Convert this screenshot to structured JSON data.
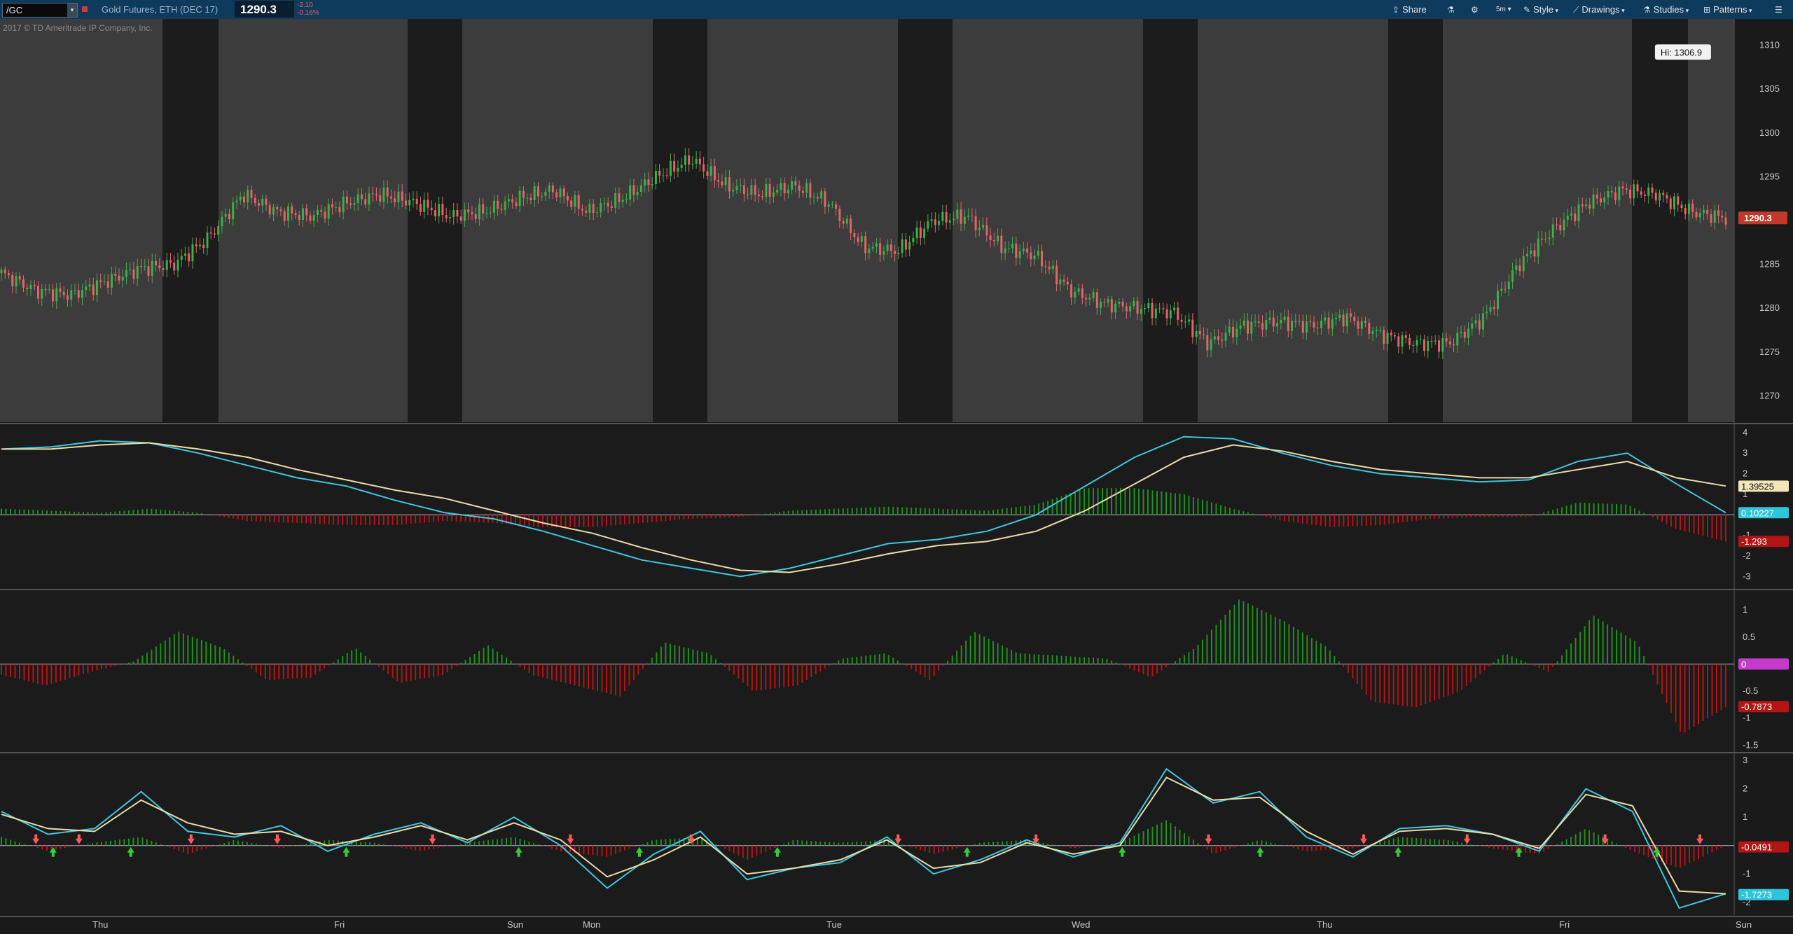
{
  "toolbar": {
    "symbol": "/GC",
    "description": "Gold Futures, ETH (DEC 17)",
    "last": "1290.3",
    "net_change": "-2.10",
    "pct_change": "-0.16%",
    "buttons": [
      {
        "icon": "share-icon",
        "label": "Share"
      },
      {
        "icon": "flask-icon",
        "label": ""
      },
      {
        "icon": "gear-icon",
        "label": ""
      },
      {
        "icon": "timeframe-icon",
        "label": "5m"
      },
      {
        "icon": "style-icon",
        "label": "Style"
      },
      {
        "icon": "drawings-icon",
        "label": "Drawings"
      },
      {
        "icon": "studies-icon",
        "label": "Studies"
      },
      {
        "icon": "patterns-icon",
        "label": "Patterns"
      },
      {
        "icon": "menu-icon",
        "label": ""
      }
    ]
  },
  "copyright": "2017 © TD Ameritrade IP Company, Inc.",
  "hi_label": "Hi: 1306.9",
  "chart_data": [
    {
      "type": "candlestick",
      "title": "Gold Futures, ETH (DEC 17)",
      "y_ticks": [
        "1310",
        "1305",
        "1300",
        "1295",
        "1290",
        "1285",
        "1280",
        "1275",
        "1270"
      ],
      "ylim": [
        1267,
        1313
      ],
      "x_labels": [
        "Thu",
        "Fri",
        "Sun",
        "Mon",
        "Tue",
        "Wed",
        "Thu",
        "Fri",
        "Sun"
      ],
      "last_price_label": "1290.3",
      "x": [
        0,
        20,
        40,
        60,
        80,
        100,
        120,
        140,
        160,
        180,
        200,
        220,
        240,
        260,
        280,
        300,
        320,
        340,
        360,
        380,
        400,
        420,
        440,
        460,
        480,
        500,
        520,
        540,
        560,
        580,
        600,
        620,
        640,
        660,
        680,
        700,
        720,
        740,
        760,
        780,
        800,
        820,
        840,
        860,
        880,
        900,
        920,
        940,
        960,
        980,
        1000
      ],
      "close": [
        1284,
        1282,
        1281.5,
        1283,
        1284.5,
        1285,
        1288,
        1293,
        1291,
        1290.5,
        1292,
        1293,
        1292,
        1290.5,
        1291,
        1292.5,
        1293.5,
        1291,
        1292.5,
        1295,
        1297,
        1294,
        1293,
        1294,
        1292,
        1287,
        1286.5,
        1290,
        1290.5,
        1287,
        1286,
        1282,
        1280.5,
        1280,
        1279.5,
        1276,
        1278,
        1278.5,
        1278,
        1279,
        1277,
        1276,
        1276,
        1279,
        1285,
        1289,
        1292,
        1293.5,
        1293,
        1291,
        1290.3
      ],
      "grid": false
    },
    {
      "type": "line+histogram",
      "title": "",
      "y_ticks": [
        "4",
        "3",
        "2",
        "1",
        "0",
        "-1",
        "-2",
        "-3"
      ],
      "ylim": [
        -3.5,
        4.2
      ],
      "value_labels": [
        "1.39525",
        "0.10227",
        "-1.293"
      ],
      "series": [
        {
          "values": [
            3.2,
            3.3,
            3.6,
            3.5,
            3.0,
            2.4,
            1.8,
            1.4,
            0.7,
            0.1,
            -0.2,
            -0.8,
            -1.5,
            -2.2,
            -2.6,
            -3.0,
            -2.6,
            -2.0,
            -1.4,
            -1.2,
            -0.8,
            0.0,
            1.4,
            2.8,
            3.8,
            3.7,
            3.0,
            2.4,
            2.0,
            1.8,
            1.6,
            1.7,
            2.6,
            3.0,
            1.5,
            0.1
          ]
        },
        {
          "values": [
            3.2,
            3.2,
            3.4,
            3.5,
            3.2,
            2.8,
            2.2,
            1.7,
            1.2,
            0.8,
            0.2,
            -0.4,
            -0.9,
            -1.6,
            -2.2,
            -2.7,
            -2.8,
            -2.4,
            -1.9,
            -1.5,
            -1.3,
            -0.8,
            0.2,
            1.5,
            2.8,
            3.4,
            3.1,
            2.6,
            2.2,
            2.0,
            1.8,
            1.8,
            2.2,
            2.6,
            1.8,
            1.4
          ]
        }
      ],
      "histogram": [
        0.3,
        0.2,
        0.1,
        0.3,
        0.1,
        -0.3,
        -0.4,
        -0.5,
        -0.5,
        -0.3,
        -0.4,
        -0.6,
        -0.6,
        -0.4,
        -0.2,
        -0.1,
        0.2,
        0.3,
        0.4,
        0.3,
        0.2,
        0.5,
        1.3,
        1.3,
        1.0,
        0.3,
        -0.3,
        -0.6,
        -0.5,
        -0.2,
        -0.1,
        -0.1,
        0.6,
        0.5,
        -0.7,
        -1.3
      ]
    },
    {
      "type": "histogram",
      "title": "",
      "y_ticks": [
        "1",
        "0.5",
        "0",
        "-0.5",
        "-1",
        "-1.5"
      ],
      "ylim": [
        -1.6,
        1.3
      ],
      "value_labels": [
        "0",
        "-0.7873"
      ],
      "values": [
        -0.2,
        -0.4,
        -0.15,
        0.05,
        0.6,
        0.3,
        -0.3,
        -0.25,
        0.3,
        -0.35,
        -0.2,
        0.35,
        -0.2,
        -0.4,
        -0.6,
        0.4,
        0.2,
        -0.5,
        -0.4,
        0.1,
        0.2,
        -0.3,
        0.6,
        0.2,
        0.15,
        0.1,
        -0.25,
        0.3,
        1.2,
        0.8,
        0.3,
        -0.7,
        -0.8,
        -0.5,
        0.2,
        -0.15,
        0.9,
        0.4,
        -1.3,
        -0.8
      ]
    },
    {
      "type": "line+histogram",
      "title": "",
      "y_ticks": [
        "3",
        "2",
        "1",
        "0",
        "-1",
        "-2"
      ],
      "ylim": [
        -2.4,
        3.1
      ],
      "value_labels": [
        "-0.0491",
        "-1.7273"
      ],
      "series": [
        {
          "values": [
            1.2,
            0.4,
            0.6,
            1.9,
            0.5,
            0.3,
            0.7,
            -0.2,
            0.4,
            0.8,
            0.1,
            1.0,
            0.0,
            -1.5,
            -0.3,
            0.5,
            -1.2,
            -0.8,
            -0.6,
            0.3,
            -1.0,
            -0.5,
            0.2,
            -0.4,
            0.1,
            2.7,
            1.5,
            1.9,
            0.3,
            -0.4,
            0.6,
            0.7,
            0.4,
            -0.2,
            2.0,
            1.2,
            -2.2,
            -1.7
          ]
        },
        {
          "values": [
            1.1,
            0.6,
            0.5,
            1.6,
            0.8,
            0.4,
            0.5,
            0.0,
            0.3,
            0.7,
            0.2,
            0.8,
            0.2,
            -1.1,
            -0.5,
            0.3,
            -1.0,
            -0.8,
            -0.5,
            0.2,
            -0.8,
            -0.6,
            0.1,
            -0.3,
            0.0,
            2.4,
            1.6,
            1.7,
            0.5,
            -0.3,
            0.5,
            0.6,
            0.4,
            -0.1,
            1.8,
            1.4,
            -1.6,
            -1.7
          ]
        }
      ],
      "histogram": [
        0.3,
        -0.2,
        0.1,
        0.3,
        -0.3,
        0.2,
        -0.1,
        0.2,
        0.1,
        -0.2,
        0.1,
        0.3,
        -0.2,
        -0.4,
        0.2,
        0.3,
        -0.5,
        0.2,
        0.1,
        0.2,
        -0.3,
        0.1,
        0.2,
        -0.1,
        0.1,
        0.9,
        -0.3,
        0.2,
        -0.2,
        -0.1,
        0.3,
        0.2,
        -0.1,
        -0.3,
        0.6,
        -0.2,
        -0.8,
        0.0
      ],
      "signal_arrows": [
        {
          "x": 20,
          "dir": "down"
        },
        {
          "x": 30,
          "dir": "up"
        },
        {
          "x": 45,
          "dir": "down"
        },
        {
          "x": 75,
          "dir": "up"
        },
        {
          "x": 110,
          "dir": "down"
        },
        {
          "x": 160,
          "dir": "down"
        },
        {
          "x": 200,
          "dir": "up"
        },
        {
          "x": 250,
          "dir": "down"
        },
        {
          "x": 300,
          "dir": "up"
        },
        {
          "x": 330,
          "dir": "down"
        },
        {
          "x": 370,
          "dir": "up"
        },
        {
          "x": 400,
          "dir": "down"
        },
        {
          "x": 450,
          "dir": "up"
        },
        {
          "x": 520,
          "dir": "down"
        },
        {
          "x": 560,
          "dir": "up"
        },
        {
          "x": 600,
          "dir": "down"
        },
        {
          "x": 650,
          "dir": "up"
        },
        {
          "x": 700,
          "dir": "down"
        },
        {
          "x": 730,
          "dir": "up"
        },
        {
          "x": 790,
          "dir": "down"
        },
        {
          "x": 810,
          "dir": "up"
        },
        {
          "x": 850,
          "dir": "down"
        },
        {
          "x": 880,
          "dir": "up"
        },
        {
          "x": 930,
          "dir": "down"
        },
        {
          "x": 960,
          "dir": "up"
        },
        {
          "x": 985,
          "dir": "down"
        }
      ]
    }
  ]
}
